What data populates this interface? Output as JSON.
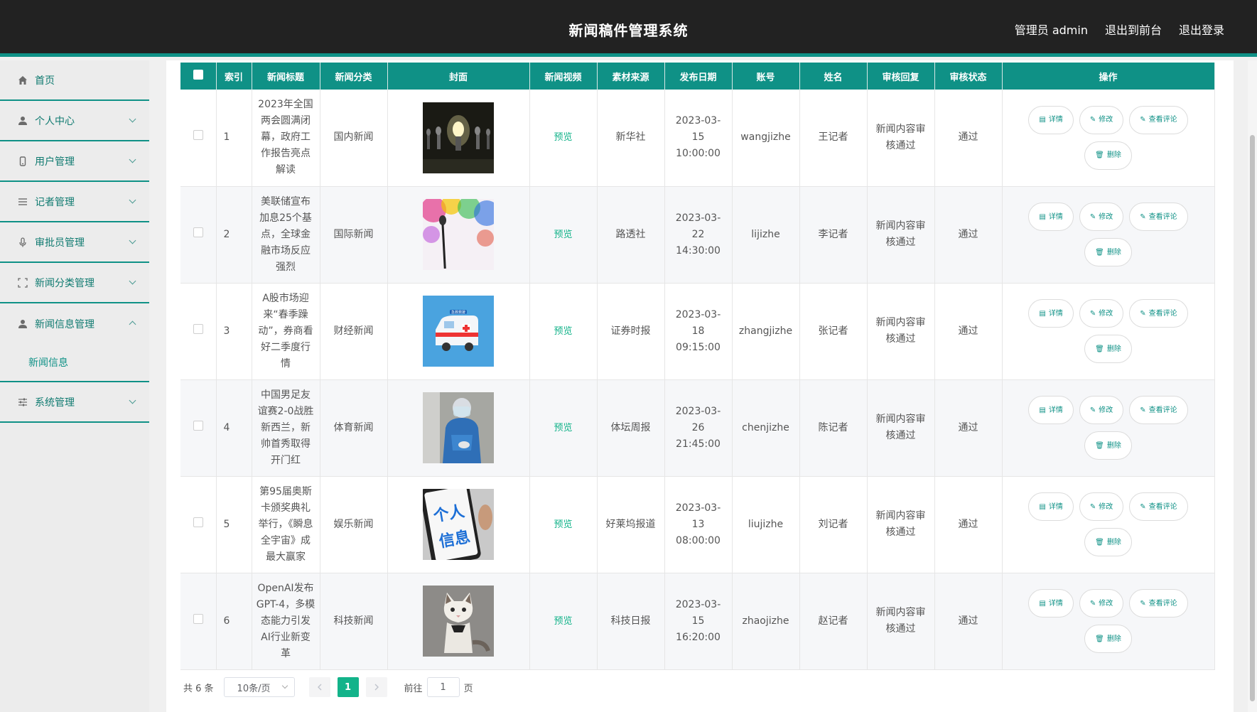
{
  "header": {
    "title": "新闻稿件管理系统",
    "admin_label": "管理员 admin",
    "exit_front": "退出到前台",
    "logout": "退出登录"
  },
  "sidebar": {
    "items": [
      {
        "label": "首页",
        "icon": "home-icon"
      },
      {
        "label": "个人中心",
        "icon": "user-icon"
      },
      {
        "label": "用户管理",
        "icon": "phone-icon"
      },
      {
        "label": "记者管理",
        "icon": "list-icon"
      },
      {
        "label": "审批员管理",
        "icon": "mic-icon"
      },
      {
        "label": "新闻分类管理",
        "icon": "frame-icon"
      },
      {
        "label": "新闻信息管理",
        "icon": "user-icon"
      },
      {
        "label": "系统管理",
        "icon": "sliders-icon"
      }
    ],
    "submenu_label": "新闻信息"
  },
  "table": {
    "headers": [
      "索引",
      "新闻标题",
      "新闻分类",
      "封面",
      "新闻视频",
      "素材来源",
      "发布日期",
      "账号",
      "姓名",
      "审核回复",
      "审核状态",
      "操作"
    ],
    "rows": [
      {
        "index": "1",
        "title": "2023年全国两会圆满闭幕，政府工作报告亮点解读",
        "category": "国内新闻",
        "video": "预览",
        "source": "新华社",
        "date": "2023-03-15 10:00:00",
        "account": "wangjizhe",
        "name": "王记者",
        "reply": "新闻内容审核通过",
        "status": "通过",
        "cover": "lightbulb"
      },
      {
        "index": "2",
        "title": "美联储宣布加息25个基点，全球金融市场反应强烈",
        "category": "国际新闻",
        "video": "预览",
        "source": "路透社",
        "date": "2023-03-22 14:30:00",
        "account": "lijizhe",
        "name": "李记者",
        "reply": "新闻内容审核通过",
        "status": "通过",
        "cover": "microphone"
      },
      {
        "index": "3",
        "title": "A股市场迎来“春季躁动”，券商看好二季度行情",
        "category": "财经新闻",
        "video": "预览",
        "source": "证券时报",
        "date": "2023-03-18 09:15:00",
        "account": "zhangjizhe",
        "name": "张记者",
        "reply": "新闻内容审核通过",
        "status": "通过",
        "cover": "ambulance"
      },
      {
        "index": "4",
        "title": "中国男足友谊赛2-0战胜新西兰，新帅首秀取得开门红",
        "category": "体育新闻",
        "video": "预览",
        "source": "体坛周报",
        "date": "2023-03-26 21:45:00",
        "account": "chenjizhe",
        "name": "陈记者",
        "reply": "新闻内容审核通过",
        "status": "通过",
        "cover": "medical"
      },
      {
        "index": "5",
        "title": "第95届奥斯卡颁奖典礼举行，《瞬息全宇宙》成最大赢家",
        "category": "娱乐新闻",
        "video": "预览",
        "source": "好莱坞报道",
        "date": "2023-03-13 08:00:00",
        "account": "liujizhe",
        "name": "刘记者",
        "reply": "新闻内容审核通过",
        "status": "通过",
        "cover": "personal-info"
      },
      {
        "index": "6",
        "title": "OpenAI发布GPT-4，多模态能力引发AI行业新变革",
        "category": "科技新闻",
        "video": "预览",
        "source": "科技日报",
        "date": "2023-03-15 16:20:00",
        "account": "zhaojizhe",
        "name": "赵记者",
        "reply": "新闻内容审核通过",
        "status": "通过",
        "cover": "cat"
      }
    ],
    "ops": {
      "detail": "详情",
      "edit": "修改",
      "comments": "查看评论",
      "delete": "删除"
    },
    "cover_text": {
      "ambulance_sign": "急救救援",
      "personal_info_1": "个人",
      "personal_info_2": "信息"
    }
  },
  "pagination": {
    "total": "共 6 条",
    "page_size": "10条/页",
    "current_page": "1",
    "goto_label": "前往",
    "goto_value": "1",
    "page_suffix": "页"
  },
  "colors": {
    "header_bg": "#222222",
    "accent": "#0f9186",
    "link_green": "#13b38a"
  }
}
